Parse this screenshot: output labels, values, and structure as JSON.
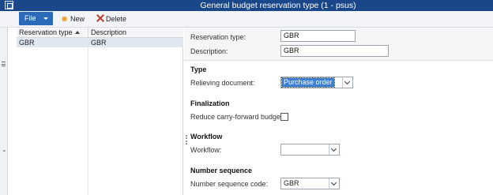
{
  "window": {
    "title": "General budget reservation type (1 - psus)"
  },
  "actionpane": {
    "file_label": "File",
    "new_label": "New",
    "delete_label": "Delete"
  },
  "grid": {
    "columns": [
      "Reservation type",
      "Description"
    ],
    "rows": [
      {
        "reservation_type": "GBR",
        "description": "GBR"
      }
    ]
  },
  "detail": {
    "reservation_type_label": "Reservation type:",
    "reservation_type_value": "GBR",
    "description_label": "Description:",
    "description_value": "GBR",
    "type_group": "Type",
    "relieving_document_label": "Relieving document:",
    "relieving_document_value": "Purchase order",
    "finalization_group": "Finalization",
    "reduce_carry_forward_label": "Reduce carry-forward budget:",
    "workflow_group": "Workflow",
    "workflow_label": "Workflow:",
    "workflow_value": "",
    "number_sequence_group": "Number sequence",
    "number_sequence_code_label": "Number sequence code:",
    "number_sequence_code_value": "GBR"
  },
  "colors": {
    "titlebar": "#19478a",
    "file_button": "#2b6ab8",
    "selection": "#3a7fd5",
    "selected_row": "#dfe7f3"
  }
}
